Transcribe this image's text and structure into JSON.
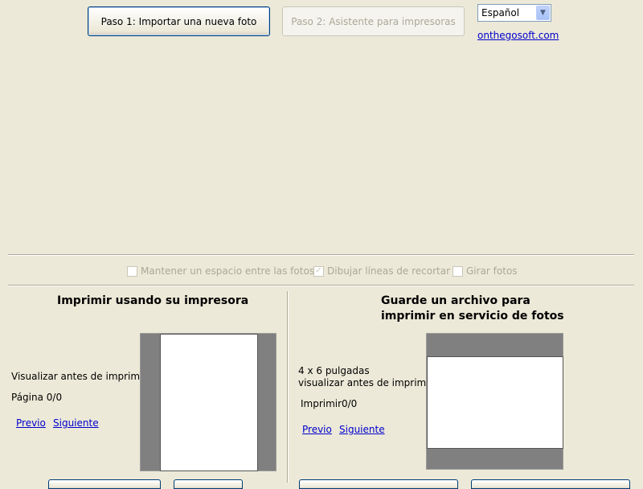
{
  "toolbar": {
    "step1_label": "Paso 1: Importar una nueva foto",
    "step2_label": "Paso 2: Asistente para impresoras",
    "language_value": "Español",
    "website_link": "onthegosoft.com"
  },
  "options": {
    "keep_space_label": "Mantener un espacio entre las fotos",
    "keep_space_checked": false,
    "crop_lines_label": "Dibujar líneas de recortar",
    "crop_lines_checked": true,
    "rotate_label": "Girar fotos",
    "rotate_checked": false
  },
  "printer_panel": {
    "title": "Imprimir usando su impresora",
    "preview_label": "Visualizar antes de imprimir",
    "page_label": "Página 0/0",
    "prev_label": "Previo",
    "next_label": "Siguiente"
  },
  "service_panel": {
    "title_line1": "Guarde un archivo para",
    "title_line2": "imprimir en servicio de fotos",
    "size_label": "4 x 6 pulgadas",
    "preview_label": "visualizar antes de imprimir",
    "print_label": "Imprimir",
    "print_count": "0/0",
    "prev_label": "Previo",
    "next_label": "Siguiente"
  },
  "colors": {
    "background": "#ece9d8",
    "link": "#0000cc",
    "preview_frame": "#808080"
  }
}
